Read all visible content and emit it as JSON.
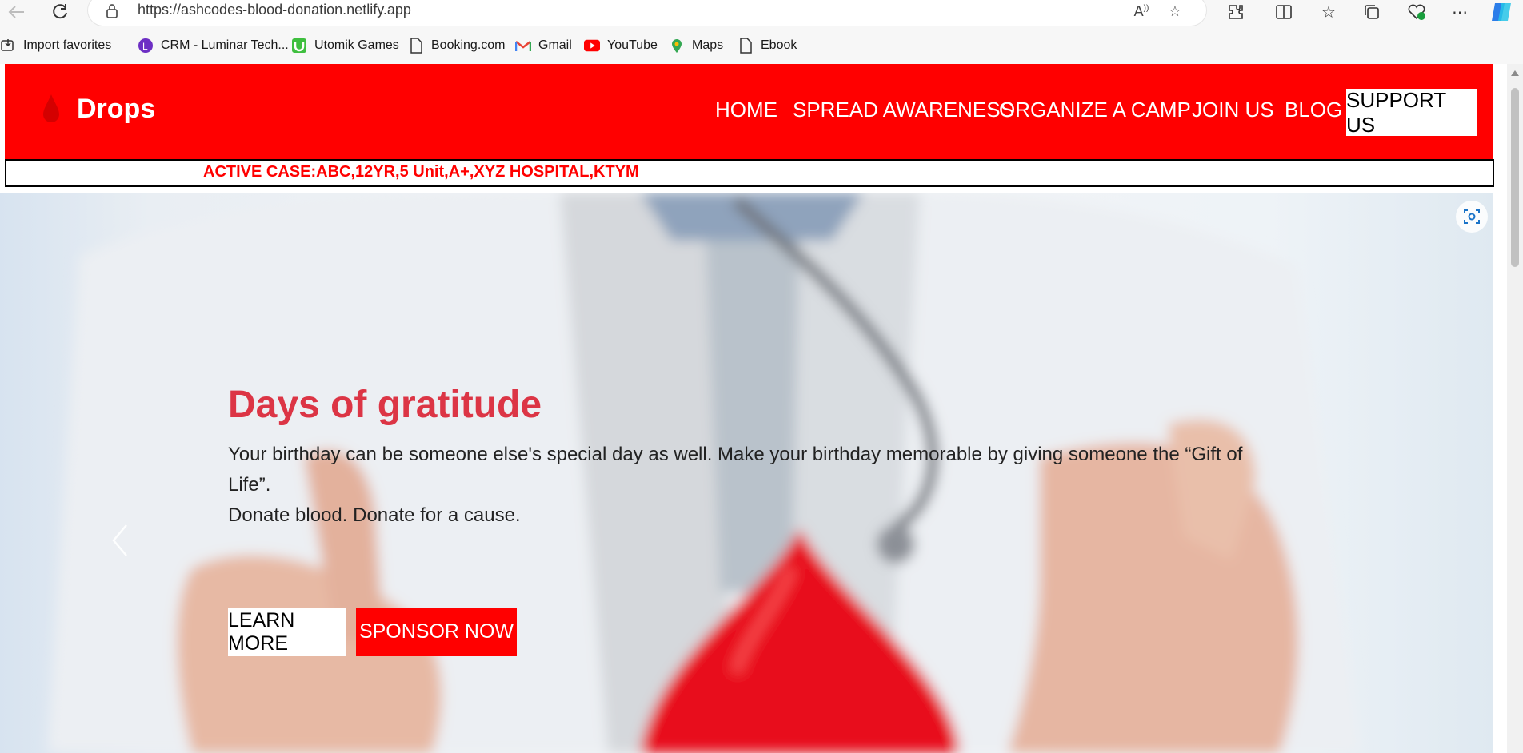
{
  "browser": {
    "url": "https://ashcodes-blood-donation.netlify.app"
  },
  "favorites": [
    {
      "label": "Import favorites",
      "icon": "import-icon"
    },
    {
      "label": "CRM - Luminar Tech...",
      "icon": "luminar-logo-icon"
    },
    {
      "label": "Utomik Games",
      "icon": "utomik-logo-icon"
    },
    {
      "label": "Booking.com",
      "icon": "page-icon"
    },
    {
      "label": "Gmail",
      "icon": "gmail-logo-icon"
    },
    {
      "label": "YouTube",
      "icon": "youtube-logo-icon"
    },
    {
      "label": "Maps",
      "icon": "maps-pin-icon"
    },
    {
      "label": "Ebook",
      "icon": "page-icon"
    }
  ],
  "site": {
    "brand": "Drops",
    "nav": [
      "HOME",
      "SPREAD AWARENESS",
      "ORGANIZE A CAMP",
      "JOIN US",
      "BLOG"
    ],
    "cta": "SUPPORT US",
    "ticker": "ACTIVE CASE:ABC,12YR,5 Unit,A+,XYZ HOSPITAL,KTYM"
  },
  "hero": {
    "title": "Days of gratitude",
    "text_line1": "Your birthday can be someone else's special day as well. Make your birthday memorable by giving someone the “Gift of Life”.",
    "text_line2": "Donate blood. Donate for a cause.",
    "learn_more": "LEARN MORE",
    "sponsor_now": "SPONSOR NOW"
  },
  "colors": {
    "brand_red": "#ff0000",
    "title_red": "#dc3545"
  }
}
